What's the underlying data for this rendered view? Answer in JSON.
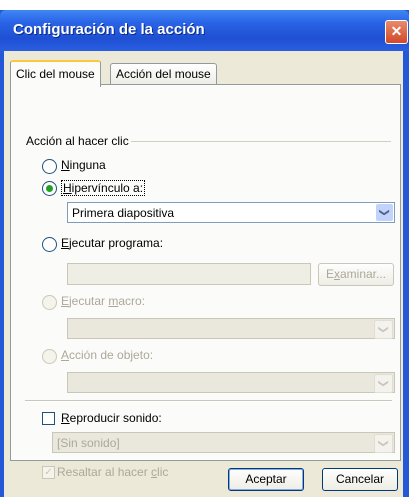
{
  "dialog": {
    "title": "Configuración de la acción",
    "close_glyph": "✕"
  },
  "tabs": [
    {
      "label": "Clic del mouse"
    },
    {
      "label": "Acción del mouse"
    }
  ],
  "group": {
    "title": "Acción al hacer clic"
  },
  "options": {
    "none": {
      "label_pre": "",
      "key": "N",
      "label_post": "inguna",
      "checked": false
    },
    "hyperlink": {
      "label_pre": "",
      "key": "H",
      "label_post": "ipervínculo a:",
      "checked": true,
      "value": "Primera diapositiva"
    },
    "run_program": {
      "label_pre": "",
      "key": "E",
      "label_post": "jecutar programa:",
      "checked": false,
      "value": "",
      "browse_pre": "E",
      "browse_key": "x",
      "browse_post": "aminar..."
    },
    "run_macro": {
      "label_pre": "",
      "key": "E",
      "label_mid": "jecutar ",
      "key2": "m",
      "label_post": "acro:",
      "disabled": true
    },
    "object_action": {
      "label_pre": "",
      "key": "A",
      "label_post": "cción de objeto:",
      "disabled": true
    }
  },
  "sound": {
    "label_pre": "",
    "key": "R",
    "label_post": "eproducir sonido:",
    "checked": false,
    "value": "[Sin sonido]"
  },
  "highlight": {
    "label_pre": "Resaltar al hacer ",
    "key": "c",
    "label_post": "lic",
    "checked": true,
    "disabled": true
  },
  "buttons": {
    "ok": "Aceptar",
    "cancel": "Cancelar"
  },
  "arrow_glyph": "❯"
}
